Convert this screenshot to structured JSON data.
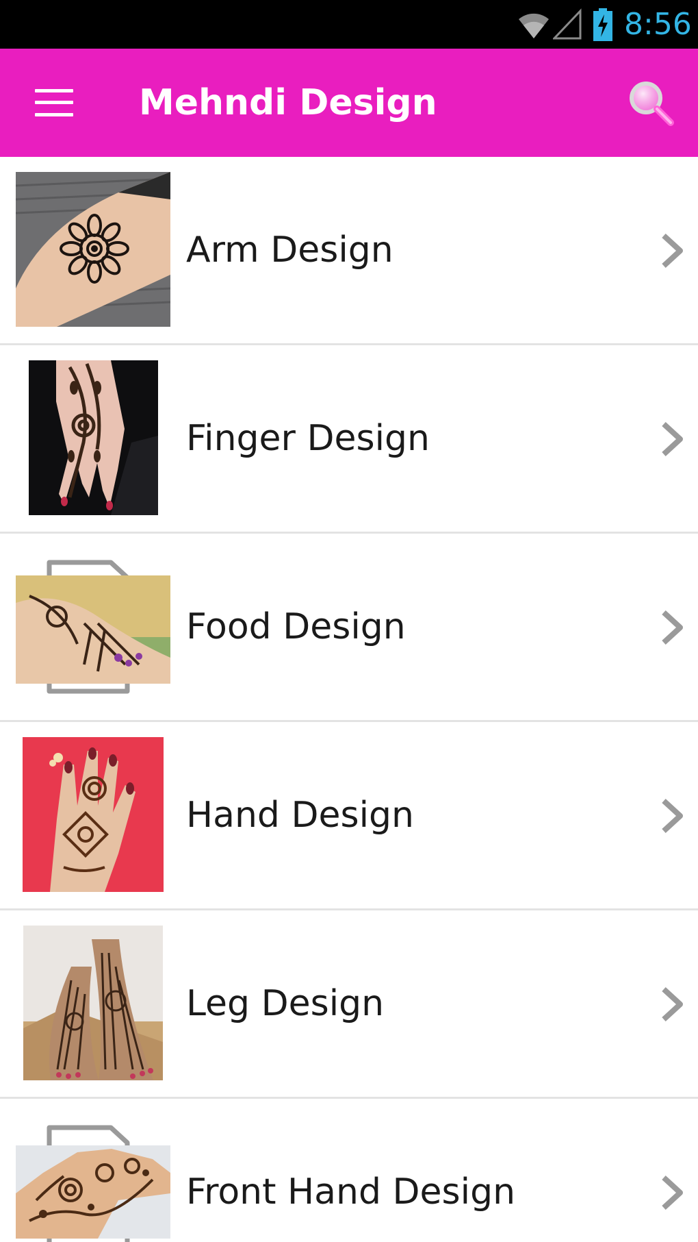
{
  "status_bar": {
    "time": "8:56",
    "icons": [
      "wifi-icon",
      "signal-icon",
      "battery-charging-icon"
    ],
    "clock_color": "#33b5e5"
  },
  "app_bar": {
    "title": "Mehndi Design",
    "background_color": "#e91ebf",
    "menu_icon": "hamburger-menu-icon",
    "search_icon": "search-icon"
  },
  "items": [
    {
      "label": "Arm Design",
      "thumbnail": "arm-mehndi-photo",
      "chevron": "chevron-right-icon"
    },
    {
      "label": "Finger Design",
      "thumbnail": "finger-mehndi-photo",
      "chevron": "chevron-right-icon"
    },
    {
      "label": "Food Design",
      "thumbnail": "foot-mehndi-photo",
      "chevron": "chevron-right-icon"
    },
    {
      "label": "Hand Design",
      "thumbnail": "hand-mehndi-photo",
      "chevron": "chevron-right-icon"
    },
    {
      "label": "Leg Design",
      "thumbnail": "leg-mehndi-photo",
      "chevron": "chevron-right-icon"
    },
    {
      "label": "Front Hand Design",
      "thumbnail": "front-hand-mehndi-photo",
      "chevron": "chevron-right-icon"
    }
  ]
}
